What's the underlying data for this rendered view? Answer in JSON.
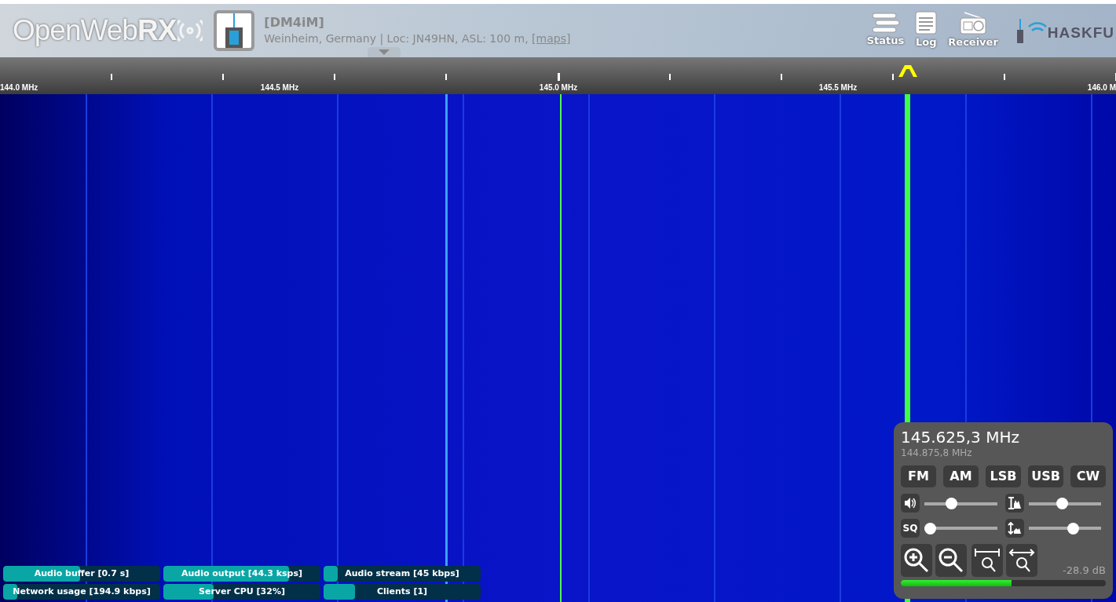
{
  "header": {
    "logo_text": "OpenWebRX",
    "station": "[DM4iM]",
    "location": "Weinheim, Germany | Loc: JN49HN, ASL: 100 m,",
    "maps_link": "[maps]",
    "nav": [
      {
        "label": "Status"
      },
      {
        "label": "Log"
      },
      {
        "label": "Receiver"
      }
    ],
    "partner_logo": "HASKFU"
  },
  "scale": {
    "labels": [
      "144.0 MHz",
      "144.5 MHz",
      "145.0 MHz",
      "145.5 MHz",
      "146.0 M"
    ]
  },
  "receiver": {
    "frequency": "145.625,3 MHz",
    "offset_frequency": "144.875,8 MHz",
    "modes": [
      "FM",
      "AM",
      "LSB",
      "USB",
      "CW"
    ],
    "sliders": [
      {
        "level": 0.35
      },
      {
        "level": 0.46
      },
      {
        "label": "SQ",
        "level": 0.0
      },
      {
        "level": 0.64
      }
    ],
    "smeter_reading": "-28.9 dB",
    "smeter": {
      "level": 0.54
    }
  },
  "status_bars": [
    {
      "label": "Audio buffer [0.7 s]",
      "level": 0.49
    },
    {
      "label": "Audio output [44.3 ksps]",
      "level": 0.8
    },
    {
      "label": "Audio stream [45 kbps]",
      "level": 0.09
    },
    {
      "label": "Network usage [194.9 kbps]",
      "level": 0.09
    },
    {
      "label": "Server CPU [32%]",
      "level": 0.32
    },
    {
      "label": "Clients [1]",
      "level": 0.2
    }
  ]
}
